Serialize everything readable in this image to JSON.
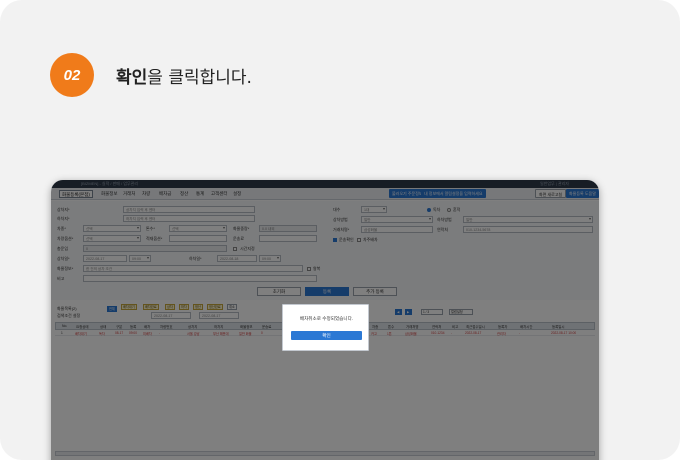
{
  "step": {
    "number": "02",
    "text_bold": "확인",
    "text_rest": "을 클릭합니다."
  },
  "window": {
    "title": "[BIZMEN] - 실적 / 판매 / 업무관리",
    "right_info": "일반업무 | 관리자"
  },
  "menubar": {
    "active_tab": "화물등록(본점)",
    "items": [
      "화물정보",
      "거래처",
      "차량",
      "배차금",
      "정산",
      "통계",
      "고객센터",
      "설정"
    ],
    "buttons": [
      "불러오기 주문정보",
      "내 정보에서 알림설정을 입력하세요",
      "화면 새로고침",
      "화물등록 도움말"
    ]
  },
  "form": {
    "left": [
      {
        "label": "상차지*",
        "value": "상차지 입력 후 엔터"
      },
      {
        "label": "하차지*",
        "value": "하차지 입력 후 엔터"
      },
      {
        "label": "차종*",
        "value": "선택"
      },
      {
        "label": "톤수*",
        "value": "선택"
      },
      {
        "label": "화물중량*",
        "value": "0.0 내외"
      },
      {
        "label": "차량옵션*",
        "value": "선택"
      },
      {
        "label": "적재옵션*",
        "value": ""
      },
      {
        "label": "운송료",
        "value": ""
      },
      {
        "label": "총운임",
        "value": "0"
      },
      {
        "label": "상차일*",
        "value": "2022-08-17"
      },
      {
        "label": "하차일*",
        "value": "2022-08-18"
      },
      {
        "label": "화물정보*",
        "value": "한 건의 상차 조건"
      },
      {
        "label": "비고",
        "value": ""
      }
    ],
    "right": [
      {
        "label": "대수",
        "value": "1대"
      },
      {
        "label": "상차방법",
        "value": "일반"
      },
      {
        "label": "하차방법",
        "value": "일반"
      },
      {
        "label": "거래처명*",
        "value": "삼성화물"
      },
      {
        "label": "연락처",
        "value": "010-1234-5678"
      }
    ],
    "radio_labels": [
      "독차",
      "혼적"
    ],
    "checkbox_labels": [
      "운송확인",
      "차주배차",
      "시간지정",
      "왕복"
    ],
    "time_start": "09:00",
    "time_end": "09:00"
  },
  "actions": {
    "reset": "초기화",
    "register": "등록",
    "add_other": "추가 등록"
  },
  "grid": {
    "section_title": "화물목록(2)",
    "sub_title": "검색조건 설정",
    "date_from": "2022-08-17",
    "date_to": "2022-08-17",
    "filter_buttons": [
      "전체",
      "배차대기",
      "배차완료",
      "상차",
      "하차",
      "정산",
      "정산완료",
      "취소"
    ],
    "columns": [
      "No.",
      "요청상태",
      "상태",
      "구분",
      "등록",
      "배차",
      "차량번호",
      "상차지",
      "하차지",
      "화물정보",
      "운송료",
      "차종",
      "톤수",
      "거래처명",
      "연락처",
      "비고",
      "최근접수일시",
      "등록자",
      "배차시간",
      "등록일시"
    ],
    "row": [
      "1",
      "배차대기",
      "독차",
      "08-17",
      "09:00",
      "미배차",
      "-",
      "서울 강남",
      "부산 해운대",
      "일반 화물",
      "0",
      "카고",
      "1톤",
      "삼성화물",
      "010-1234",
      "-",
      "2022-08-17",
      "관리자",
      "-",
      "2022-08-17 10:00"
    ],
    "page_label": "1 / 3",
    "settings_label": "컬럼설정"
  },
  "dialog": {
    "message": "배차취소로 수정되었습니다.",
    "ok_label": "확인"
  },
  "colors": {
    "accent": "#2b78d4",
    "step_badge": "#f07b1a",
    "overlay": "rgba(0,0,0,0.5)"
  }
}
